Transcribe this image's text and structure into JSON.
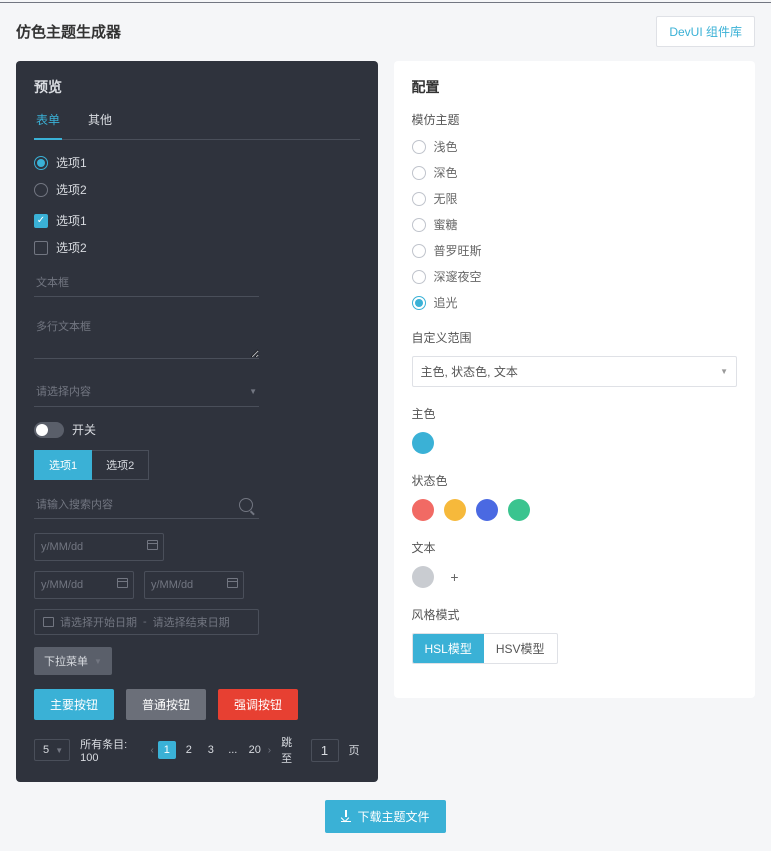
{
  "header": {
    "title": "仿色主题生成器",
    "devui_btn": "DevUI 组件库"
  },
  "preview": {
    "title": "预览",
    "tabs": [
      {
        "label": "表单",
        "active": true
      },
      {
        "label": "其他",
        "active": false
      }
    ],
    "radios": [
      {
        "label": "选项1",
        "checked": true
      },
      {
        "label": "选项2",
        "checked": false
      }
    ],
    "checks": [
      {
        "label": "选项1",
        "checked": true
      },
      {
        "label": "选项2",
        "checked": false
      }
    ],
    "input_ph": "文本框",
    "textarea_ph": "多行文本框",
    "select_ph": "请选择内容",
    "switch_label": "开关",
    "seg": [
      {
        "label": "选项1",
        "active": true
      },
      {
        "label": "选项2",
        "active": false
      }
    ],
    "search_ph": "请输入搜索内容",
    "date_ph": "y/MM/dd",
    "range_start": "请选择开始日期",
    "range_sep": "-",
    "range_end": "请选择结束日期",
    "dropdown_btn": "下拉菜单",
    "buttons": {
      "primary": "主要按钮",
      "plain": "普通按钮",
      "danger": "强调按钮"
    },
    "pager": {
      "size": "5",
      "total_label": "所有条目: 100",
      "pages": [
        "1",
        "2",
        "3",
        "...",
        "20"
      ],
      "active": "1",
      "jump_label": "跳至",
      "jump_val": "1",
      "page_suffix": "页"
    }
  },
  "config": {
    "title": "配置",
    "theme_label": "模仿主题",
    "themes": [
      {
        "label": "浅色",
        "checked": false
      },
      {
        "label": "深色",
        "checked": false
      },
      {
        "label": "无限",
        "checked": false
      },
      {
        "label": "蜜糖",
        "checked": false
      },
      {
        "label": "普罗旺斯",
        "checked": false
      },
      {
        "label": "深邃夜空",
        "checked": false
      },
      {
        "label": "追光",
        "checked": true
      }
    ],
    "scope_label": "自定义范围",
    "scope_value": "主色, 状态色, 文本",
    "maincolor_label": "主色",
    "maincolor": "#3ab1d6",
    "status_label": "状态色",
    "status_colors": [
      "#f16a64",
      "#f6b93b",
      "#4a69e2",
      "#3ac48f"
    ],
    "text_label": "文本",
    "text_color": "#c9ccd1",
    "mode_label": "风格模式",
    "modes": [
      {
        "label": "HSL模型",
        "active": true
      },
      {
        "label": "HSV模型",
        "active": false
      }
    ]
  },
  "footer": {
    "download": "下载主题文件"
  }
}
